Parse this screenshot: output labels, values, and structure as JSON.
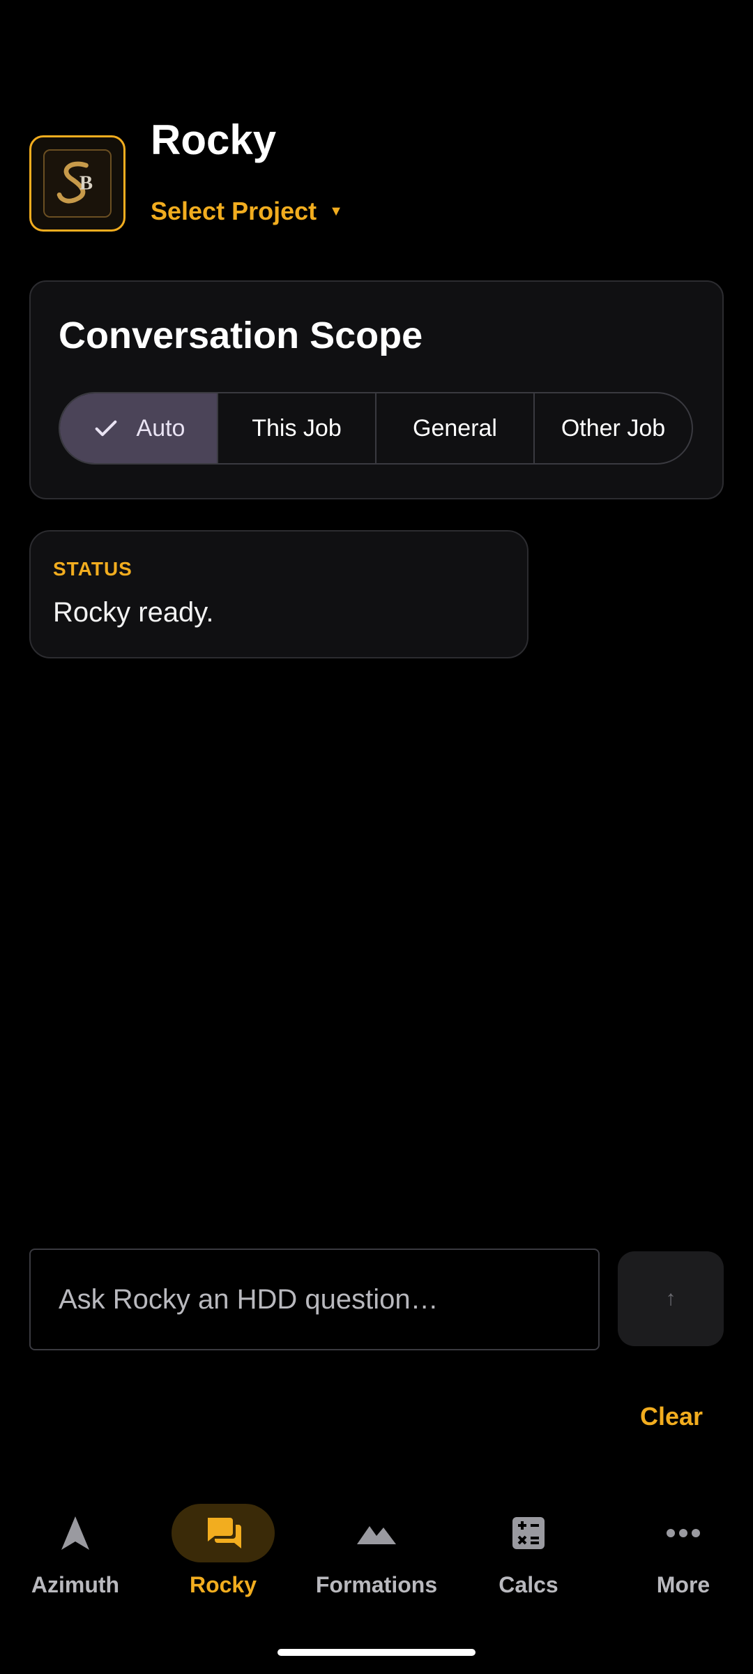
{
  "header": {
    "app_title": "Rocky",
    "project_select_label": "Select Project",
    "logo_icon": "sb-logo-icon"
  },
  "scope": {
    "title": "Conversation Scope",
    "options": [
      {
        "label": "Auto",
        "active": true
      },
      {
        "label": "This Job",
        "active": false
      },
      {
        "label": "General",
        "active": false
      },
      {
        "label": "Other Job",
        "active": false
      }
    ]
  },
  "status": {
    "label": "STATUS",
    "text": "Rocky ready."
  },
  "composer": {
    "placeholder": "Ask Rocky an HDD question…",
    "send_symbol": "↑",
    "clear_label": "Clear"
  },
  "nav": {
    "items": [
      {
        "label": "Azimuth",
        "icon": "navigation-arrow-icon"
      },
      {
        "label": "Rocky",
        "icon": "chat-icon",
        "active": true
      },
      {
        "label": "Formations",
        "icon": "mountain-icon"
      },
      {
        "label": "Calcs",
        "icon": "calculator-icon"
      },
      {
        "label": "More",
        "icon": "more-horizontal-icon"
      }
    ]
  },
  "colors": {
    "accent": "#f2ad1f",
    "active_segment": "#4b4458",
    "card_bg": "#101012"
  }
}
